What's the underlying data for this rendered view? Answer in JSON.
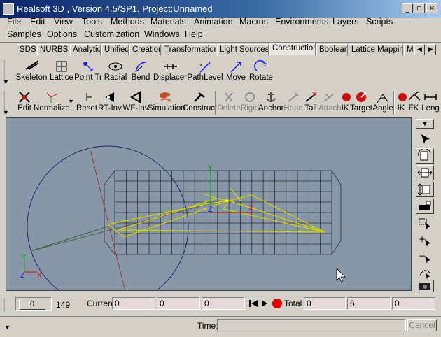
{
  "window": {
    "title": "Realsoft 3D , Version 4.5/SP1. Project:Unnamed",
    "minimize_icon": "minimize-icon",
    "restore_icon": "restore-icon",
    "close_icon": "close-icon"
  },
  "menu": {
    "row1": [
      "File",
      "Edit",
      "View",
      "Tools",
      "Methods",
      "Materials",
      "Animation",
      "Macros",
      "Environments",
      "Layers",
      "Scripts"
    ],
    "row2": [
      "Samples",
      "Options",
      "Customization",
      "Windows",
      "Help"
    ]
  },
  "tabs": {
    "items": [
      "SDS",
      "NURBS",
      "Analytic",
      "Unified",
      "Creation",
      "Transformation",
      "Light Sources",
      "Construction",
      "Boolean",
      "Lattice Mapping",
      "M"
    ],
    "active": "Construction",
    "scroll_left": "◀",
    "scroll_right": "▶"
  },
  "toolbar1": {
    "items": [
      "Skeleton",
      "Lattice",
      "Point Tr",
      "Radial",
      "Bend",
      "Displacer",
      "PathLevel",
      "Move",
      "Rotate"
    ],
    "more_arrow": "▼"
  },
  "toolbar2": {
    "group1": [
      "Edit",
      "Normalize",
      "Reset",
      "RT-Inv",
      "WF-Inv",
      "Simulation",
      "Construct"
    ],
    "group2": [
      "Delete",
      "Rigid",
      "Anchor",
      "Head",
      "Tail",
      "Attach",
      "IK",
      "Target",
      "Angle"
    ],
    "group2_disabled": [
      "Delete",
      "Rigid",
      "Head",
      "Attach"
    ],
    "group3": [
      "IK",
      "FK",
      "Leng"
    ],
    "more_arrow": "▼"
  },
  "viewport": {
    "axis_labels": {
      "x": "X",
      "y": "Y",
      "z": "Z"
    },
    "dropdown_arrow": "▼"
  },
  "timeline": {
    "frame_value": "0",
    "frame_end": "149",
    "current_label": "Current",
    "current_values": [
      "0",
      "0",
      "0"
    ],
    "total_label": "Total",
    "total_values": [
      "0",
      "6",
      "0"
    ]
  },
  "statusbar": {
    "time_label": "Time:",
    "time_value": "",
    "cancel_label": "Cancel"
  },
  "colors": {
    "viewport_bg": "#8797a7",
    "selection_yellow": "#d6d000",
    "bone_red": "#d01010",
    "axis_green": "#00b000",
    "axis_blue": "#1a1aff"
  }
}
